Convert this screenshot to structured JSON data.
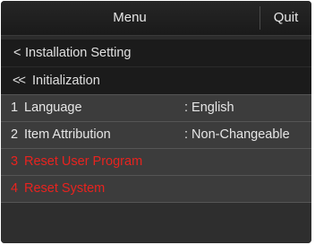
{
  "header": {
    "title": "Menu",
    "quit_label": "Quit"
  },
  "breadcrumbs": [
    {
      "chevron": "<",
      "label": "Installation Setting"
    },
    {
      "chevron": "<<",
      "label": "Initialization"
    }
  ],
  "items": [
    {
      "number": "1",
      "label": "Language",
      "value": ": English",
      "color": "#e6e6e6"
    },
    {
      "number": "2",
      "label": "Item Attribution",
      "value": ": Non-Changeable",
      "color": "#e6e6e6"
    },
    {
      "number": "3",
      "label": "Reset User Program",
      "value": "",
      "color": "#e8231f"
    },
    {
      "number": "4",
      "label": "Reset System",
      "value": "",
      "color": "#e8231f"
    }
  ],
  "colors": {
    "background": "#2b2b2b",
    "row_background": "#3c3c3c",
    "text": "#e6e6e6",
    "alert": "#e8231f"
  }
}
